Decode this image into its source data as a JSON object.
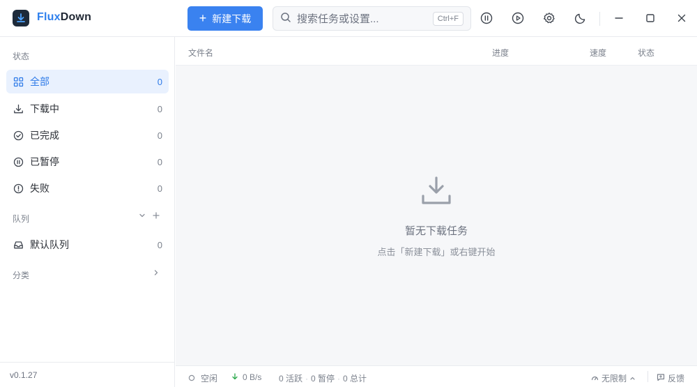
{
  "app": {
    "title_part1": "Flux",
    "title_part2": "Down",
    "accent_color": "#3a82f0"
  },
  "toolbar": {
    "new_download_label": "新建下载",
    "search_placeholder": "搜索任务或设置...",
    "search_shortcut": "Ctrl+F",
    "icons": [
      "pause-all-icon",
      "resume-all-icon",
      "settings-icon",
      "theme-moon-icon",
      "minimize-icon",
      "maximize-icon",
      "close-icon"
    ]
  },
  "sidebar": {
    "status_title": "状态",
    "status_items": [
      {
        "label": "全部",
        "count": "0",
        "icon": "grid-icon",
        "active": true
      },
      {
        "label": "下载中",
        "count": "0",
        "icon": "download-icon"
      },
      {
        "label": "已完成",
        "count": "0",
        "icon": "check-circle-icon"
      },
      {
        "label": "已暂停",
        "count": "0",
        "icon": "pause-circle-icon"
      },
      {
        "label": "失败",
        "count": "0",
        "icon": "alert-circle-icon"
      }
    ],
    "queue_title": "队列",
    "queue_items": [
      {
        "label": "默认队列",
        "count": "0",
        "icon": "inbox-icon"
      }
    ],
    "category_title": "分类",
    "version": "v0.1.27"
  },
  "table": {
    "columns": [
      "文件名",
      "进度",
      "速度",
      "状态"
    ]
  },
  "empty_state": {
    "title": "暂无下载任务",
    "subtitle": "点击「新建下载」或右键开始"
  },
  "statusbar": {
    "state": "空闲",
    "speed": "0 B/s",
    "active": "0 活跃",
    "paused": "0 暂停",
    "total": "0 总计",
    "limit": "无限制",
    "feedback": "反馈"
  }
}
